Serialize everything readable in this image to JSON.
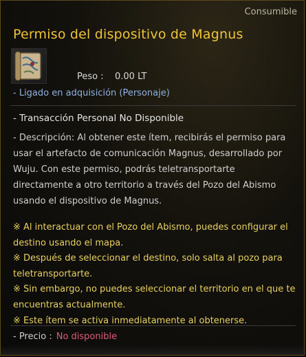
{
  "tooltip": {
    "category": "Consumible",
    "title": "Permiso del dispositivo de Magnus",
    "icon": "scroll-map-icon",
    "weight_label": "Peso :",
    "weight_value": "0.00 LT",
    "bound": "- Ligado en adquisición (Personaje)",
    "trade": "- Transacción Personal No Disponible",
    "description": "- Descripción: Al obtener este ítem, recibirás el permiso para usar el artefacto de comunicación Magnus, desarrollado por Wuju. Con este permiso, podrás teletransportarte directamente a otro territorio a través del Pozo del Abismo usando el dispositivo de Magnus.",
    "notes": [
      "※ Al interactuar con el Pozo del Abismo, puedes configurar el destino usando el mapa.",
      "※ Después de seleccionar el destino, solo salta al pozo para teletransportarte.",
      "※ Sin embargo, no puedes seleccionar el territorio en el que te encuentras actualmente.",
      "※ Este ítem se activa inmediatamente al obtenerse."
    ],
    "price_label": "- Precio :",
    "price_value": "No disponible",
    "colors": {
      "title": "#f0c437",
      "bound": "#8fb0e0",
      "notes": "#e8d060",
      "price_value": "#e05a78"
    }
  }
}
